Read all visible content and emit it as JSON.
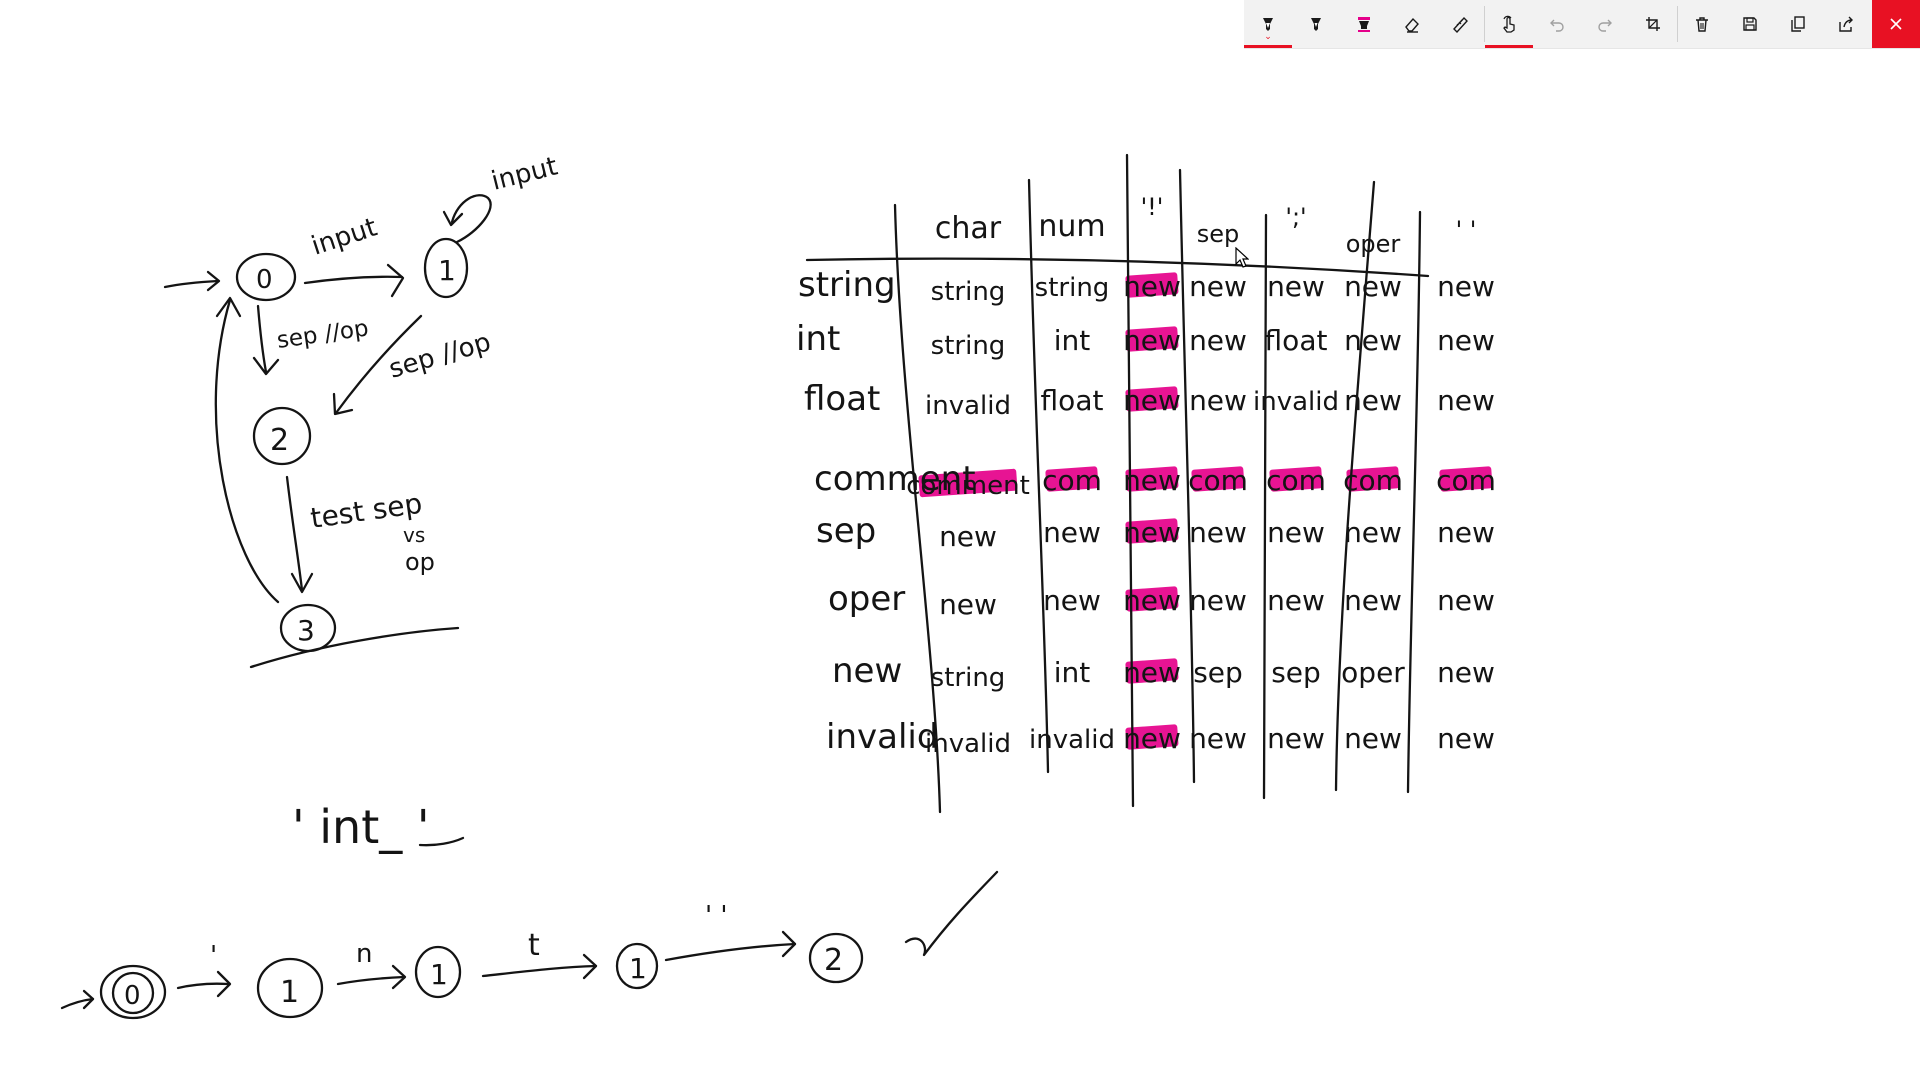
{
  "toolbar": {
    "buttons": [
      {
        "name": "ballpoint-pen",
        "icon": "ballpoint-pen-icon",
        "active": true
      },
      {
        "name": "pencil",
        "icon": "pencil-icon"
      },
      {
        "name": "highlighter",
        "icon": "highlighter-icon",
        "color": "#e5008a"
      },
      {
        "name": "eraser",
        "icon": "eraser-icon"
      },
      {
        "name": "ruler",
        "icon": "ruler-icon"
      },
      {
        "name": "touch-writing",
        "icon": "touch-writing-icon",
        "active": true
      },
      {
        "name": "undo",
        "icon": "undo-icon",
        "disabled": true
      },
      {
        "name": "redo",
        "icon": "redo-icon",
        "disabled": true
      },
      {
        "name": "crop",
        "icon": "crop-icon"
      },
      {
        "name": "delete",
        "icon": "delete-icon"
      },
      {
        "name": "save",
        "icon": "save-icon"
      },
      {
        "name": "copy",
        "icon": "copy-icon"
      },
      {
        "name": "share",
        "icon": "share-icon"
      },
      {
        "name": "close",
        "icon": "close-icon",
        "color": "#e81123"
      }
    ]
  },
  "ink": {
    "color": "#141414",
    "highlight_color": "#e5008a",
    "state_diagram": {
      "states": [
        "0",
        "1",
        "2",
        "3"
      ],
      "labels": {
        "input_a": "input",
        "input_b": "input",
        "sep_op_a": "sep //op",
        "sep_op_b": "sep //op",
        "test": "test sep",
        "vs": "vs",
        "op": "op"
      }
    },
    "table": {
      "columns": [
        "char",
        "num",
        "'!'",
        "sep",
        "';'",
        "oper",
        "' '"
      ],
      "rows": [
        {
          "label": "string",
          "cells": [
            "string",
            "string",
            "new",
            "new",
            "new",
            "new",
            "new"
          ]
        },
        {
          "label": "int",
          "cells": [
            "string",
            "int",
            "new",
            "new",
            "float",
            "new",
            "new"
          ]
        },
        {
          "label": "float",
          "cells": [
            "invalid",
            "float",
            "new",
            "new",
            "invalid",
            "new",
            "new"
          ]
        },
        {
          "label": "comment",
          "cells": [
            "comment",
            "com",
            "new",
            "com",
            "com",
            "com",
            "com"
          ]
        },
        {
          "label": "sep",
          "cells": [
            "new",
            "new",
            "new",
            "new",
            "new",
            "new",
            "new"
          ]
        },
        {
          "label": "oper",
          "cells": [
            "new",
            "new",
            "new",
            "new",
            "new",
            "new",
            "new"
          ]
        },
        {
          "label": "new",
          "cells": [
            "string",
            "int",
            "new",
            "sep",
            "sep",
            "oper",
            "new"
          ]
        },
        {
          "label": "invalid",
          "cells": [
            "invalid",
            "invalid",
            "new",
            "new",
            "new",
            "new",
            "new"
          ]
        }
      ]
    },
    "example": {
      "text": "' int_ '",
      "states": [
        "0",
        "1",
        "1",
        "1",
        "2"
      ],
      "transitions": [
        "'",
        "n",
        "t",
        "' '"
      ],
      "checkmark": "✓"
    }
  }
}
